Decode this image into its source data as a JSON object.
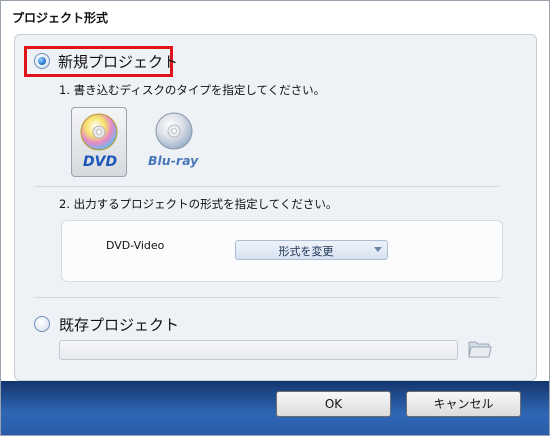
{
  "window": {
    "title": "プロジェクト形式"
  },
  "new_project": {
    "label": "新規プロジェクト",
    "selected": true,
    "step1_label": "1. 書き込むディスクのタイプを指定してください。",
    "disc_types": [
      {
        "label": "DVD",
        "icon": "dvd-disc-icon",
        "selected": true
      },
      {
        "label": "Blu-ray",
        "icon": "bluray-disc-icon",
        "selected": false
      }
    ],
    "step2_label": "2. 出力するプロジェクトの形式を指定してください。",
    "format": {
      "current": "DVD-Video",
      "change_button": "形式を変更"
    }
  },
  "existing_project": {
    "label": "既存プロジェクト",
    "selected": false,
    "path_value": "",
    "browse_icon": "folder-icon"
  },
  "footer": {
    "ok_label": "OK",
    "cancel_label": "キャンセル"
  },
  "colors": {
    "highlight": "#e0131b",
    "footer": "#2a5ca8",
    "radio_selected": "#2f7fd0"
  }
}
